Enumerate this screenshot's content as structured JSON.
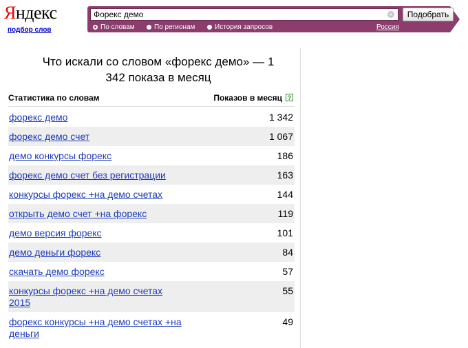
{
  "logo": {
    "text_first": "Я",
    "text_rest": "ндекс",
    "sub_link": "подбор слов"
  },
  "search": {
    "query": "Форекс демо",
    "submit_label": "Подобрать",
    "modes": [
      {
        "label": "По словам",
        "selected": true
      },
      {
        "label": "По регионам",
        "selected": false
      },
      {
        "label": "История запросов",
        "selected": false
      }
    ],
    "region": "Россия"
  },
  "results": {
    "heading": "Что искали со словом «форекс демо» — 1 342 показа в месяц",
    "col_keyword": "Статистика по словам",
    "col_count": "Показов в месяц",
    "help": "?",
    "rows": [
      {
        "keyword": "форекс демо",
        "count": "1 342"
      },
      {
        "keyword": "форекс демо счет",
        "count": "1 067"
      },
      {
        "keyword": "демо конкурсы форекс",
        "count": "186"
      },
      {
        "keyword": "форекс демо счет без регистрации",
        "count": "163"
      },
      {
        "keyword": "конкурсы форекс +на демо счетах",
        "count": "144"
      },
      {
        "keyword": "открыть демо счет +на форекс",
        "count": "119"
      },
      {
        "keyword": "демо версия форекс",
        "count": "101"
      },
      {
        "keyword": "демо деньги форекс",
        "count": "84"
      },
      {
        "keyword": "скачать демо форекс",
        "count": "57"
      },
      {
        "keyword": "конкурсы форекс +на демо счетах 2015",
        "count": "55"
      },
      {
        "keyword": "форекс конкурсы +на демо счетах +на деньги",
        "count": "49"
      }
    ]
  },
  "colors": {
    "brand_bar": "#8c3d6e",
    "link": "#1d3bb8",
    "logo_accent": "#ee0000"
  }
}
